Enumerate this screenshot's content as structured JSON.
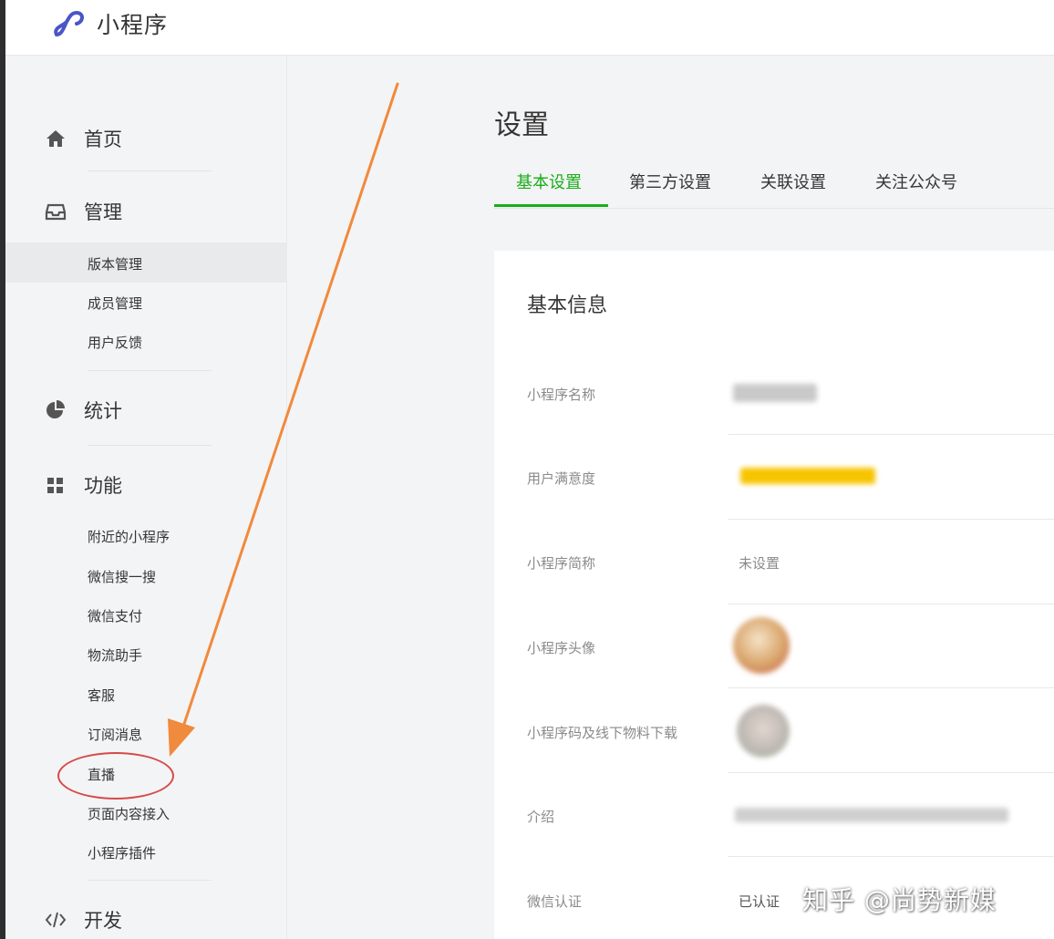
{
  "header": {
    "app_title": "小程序"
  },
  "sidebar": {
    "groups": [
      {
        "label": "首页",
        "icon": "home-icon"
      },
      {
        "label": "管理",
        "icon": "inbox-icon",
        "items": [
          "版本管理",
          "成员管理",
          "用户反馈"
        ]
      },
      {
        "label": "统计",
        "icon": "pie-chart-icon"
      },
      {
        "label": "功能",
        "icon": "grid-icon",
        "items": [
          "附近的小程序",
          "微信搜一搜",
          "微信支付",
          "物流助手",
          "客服",
          "订阅消息",
          "直播",
          "页面内容接入",
          "小程序插件"
        ]
      },
      {
        "label": "开发",
        "icon": "code-icon"
      }
    ],
    "active_item": "版本管理",
    "highlighted_item": "直播"
  },
  "main": {
    "title": "设置",
    "tabs": [
      "基本设置",
      "第三方设置",
      "关联设置",
      "关注公众号"
    ],
    "active_tab": "基本设置",
    "section_title": "基本信息",
    "rows": [
      {
        "label": "小程序名称",
        "value": ""
      },
      {
        "label": "用户满意度",
        "value": ""
      },
      {
        "label": "小程序简称",
        "value": "未设置"
      },
      {
        "label": "小程序头像",
        "value": ""
      },
      {
        "label": "小程序码及线下物料下载",
        "value": ""
      },
      {
        "label": "介绍",
        "value": ""
      },
      {
        "label": "微信认证",
        "value": "已认证"
      }
    ]
  },
  "watermark": "知乎 @尚势新媒",
  "colors": {
    "accent_green": "#1aad19",
    "annotation_orange": "#f08a3c",
    "annotation_red": "#d74a4a",
    "logo_blue": "#4a55c8"
  }
}
